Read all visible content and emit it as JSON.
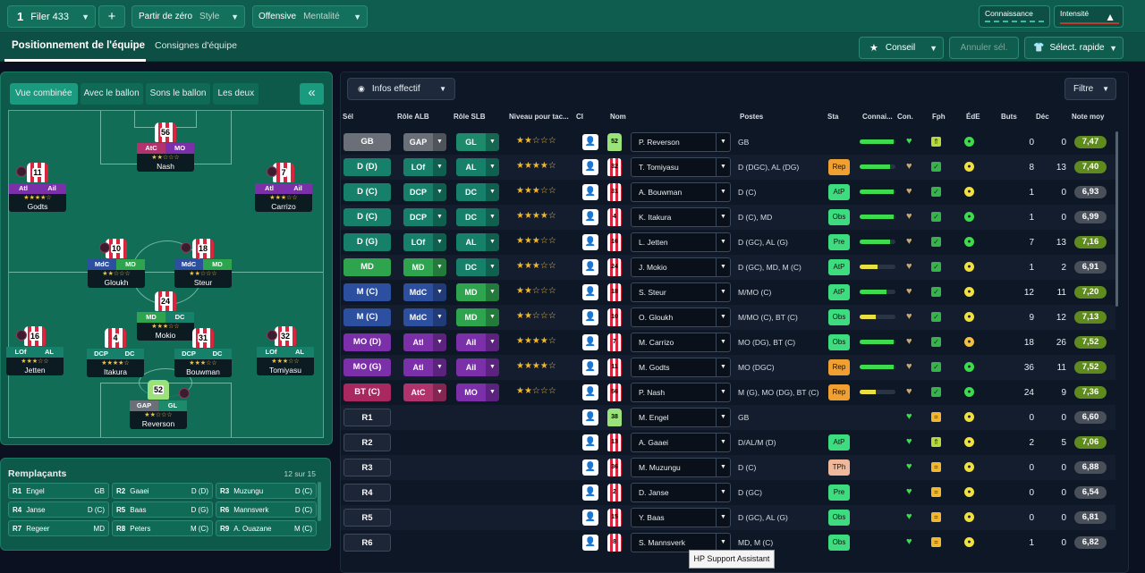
{
  "topbar": {
    "formation_number": "1",
    "formation_label": "Filer 433",
    "add_label": "+",
    "style_label": "Partir de zéro",
    "style_value": "Style",
    "mentality_label": "Offensive",
    "mentality_value": "Mentalité",
    "knowledge_label": "Connaissance",
    "intensity_label": "Intensité"
  },
  "tabs": {
    "positioning": "Positionnement de l'équipe",
    "instructions": "Consignes d'équipe"
  },
  "actions": {
    "advice": "Conseil",
    "cancel": "Annuler sél.",
    "quick_select": "Sélect. rapide"
  },
  "view_toggle": {
    "combined": "Vue combinée",
    "with_ball": "Avec le ballon",
    "without_ball": "Sons le ballon",
    "both": "Les deux",
    "collapse": "«"
  },
  "pitch_players": [
    {
      "num": "56",
      "r1": "AtC",
      "r2": "MO",
      "stars": "★★☆☆☆",
      "name": "Nash"
    },
    {
      "num": "11",
      "r1": "Atl",
      "r2": "Ail",
      "stars": "★★★★☆",
      "name": "Godts"
    },
    {
      "num": "7",
      "r1": "Atl",
      "r2": "Ail",
      "stars": "★★★☆☆",
      "name": "Carrizo"
    },
    {
      "num": "10",
      "r1": "MdC",
      "r2": "MD",
      "stars": "★★☆☆☆",
      "name": "Gloukh"
    },
    {
      "num": "18",
      "r1": "MdC",
      "r2": "MD",
      "stars": "★★☆☆☆",
      "name": "Steur"
    },
    {
      "num": "24",
      "r1": "MD",
      "r2": "DC",
      "stars": "★★★☆☆",
      "name": "Mokio"
    },
    {
      "num": "16",
      "r1": "LOf",
      "r2": "AL",
      "stars": "★★★☆☆",
      "name": "Jetten"
    },
    {
      "num": "4",
      "r1": "DCP",
      "r2": "DC",
      "stars": "★★★★☆",
      "name": "Itakura"
    },
    {
      "num": "31",
      "r1": "DCP",
      "r2": "DC",
      "stars": "★★★☆☆",
      "name": "Bouwman"
    },
    {
      "num": "32",
      "r1": "LOf",
      "r2": "AL",
      "stars": "★★★☆☆",
      "name": "Tomiyasu"
    },
    {
      "num": "52",
      "r1": "GAP",
      "r2": "GL",
      "stars": "★★☆☆☆",
      "name": "Reverson"
    }
  ],
  "subs": {
    "title": "Remplaçants",
    "count": "12 sur 15",
    "items": [
      {
        "slot": "R1",
        "name": "Engel",
        "pos": "GB"
      },
      {
        "slot": "R2",
        "name": "Gaaei",
        "pos": "D (D)"
      },
      {
        "slot": "R3",
        "name": "Muzungu",
        "pos": "D (C)"
      },
      {
        "slot": "R4",
        "name": "Janse",
        "pos": "D (C)"
      },
      {
        "slot": "R5",
        "name": "Baas",
        "pos": "D (G)"
      },
      {
        "slot": "R6",
        "name": "Mannsverk",
        "pos": "D (C)"
      },
      {
        "slot": "R7",
        "name": "Regeer",
        "pos": "MD"
      },
      {
        "slot": "R8",
        "name": "Peters",
        "pos": "M (C)"
      },
      {
        "slot": "R9",
        "name": "A. Ouazane",
        "pos": "M (C)"
      }
    ]
  },
  "main": {
    "info_button": "Infos effectif",
    "filter_button": "Filtre"
  },
  "columns": [
    "Sél",
    "Rôle ALB",
    "Rôle SLB",
    "Niveau pour tac...",
    "CI",
    "Nom",
    "Postes",
    "Sta",
    "Connai...",
    "Con.",
    "Fph",
    "ÉdE",
    "Buts",
    "Déc",
    "Note moy"
  ],
  "rows": [
    {
      "sel": "GB",
      "alb": "GAP",
      "slb": "GL",
      "stars": "★★☆☆☆",
      "num": "52",
      "name": "P. Reverson",
      "pos": "GB",
      "sta": "",
      "know": 0.95,
      "goals": "0",
      "dec": "0",
      "note": "7,47"
    },
    {
      "sel": "D (D)",
      "alb": "LOf",
      "slb": "AL",
      "stars": "★★★★☆",
      "num": "32",
      "name": "T. Tomiyasu",
      "pos": "D (DGC), AL (DG)",
      "sta": "Rep",
      "know": 0.85,
      "goals": "8",
      "dec": "13",
      "note": "7,40"
    },
    {
      "sel": "D (C)",
      "alb": "DCP",
      "slb": "DC",
      "stars": "★★★☆☆",
      "num": "31",
      "name": "A. Bouwman",
      "pos": "D (C)",
      "sta": "AtP",
      "know": 0.95,
      "goals": "1",
      "dec": "0",
      "note": "6,93"
    },
    {
      "sel": "D (C)",
      "alb": "DCP",
      "slb": "DC",
      "stars": "★★★★☆",
      "num": "4",
      "name": "K. Itakura",
      "pos": "D (C), MD",
      "sta": "Obs",
      "know": 0.95,
      "goals": "1",
      "dec": "0",
      "note": "6,99"
    },
    {
      "sel": "D (G)",
      "alb": "LOf",
      "slb": "AL",
      "stars": "★★★☆☆",
      "num": "16",
      "name": "L. Jetten",
      "pos": "D (GC), AL (G)",
      "sta": "Pre",
      "know": 0.85,
      "goals": "7",
      "dec": "13",
      "note": "7,16"
    },
    {
      "sel": "MD",
      "alb": "MD",
      "slb": "DC",
      "stars": "★★★☆☆",
      "num": "24",
      "name": "J. Mokio",
      "pos": "D (GC), MD, M (C)",
      "sta": "AtP",
      "know": 0.5,
      "goals": "1",
      "dec": "2",
      "note": "6,91"
    },
    {
      "sel": "M (C)",
      "alb": "MdC",
      "slb": "MD",
      "stars": "★★☆☆☆",
      "num": "18",
      "name": "S. Steur",
      "pos": "M/MO (C)",
      "sta": "AtP",
      "know": 0.75,
      "goals": "12",
      "dec": "11",
      "note": "7,20"
    },
    {
      "sel": "M (C)",
      "alb": "MdC",
      "slb": "MD",
      "stars": "★★☆☆☆",
      "num": "10",
      "name": "O. Gloukh",
      "pos": "M/MO (C), BT (C)",
      "sta": "Obs",
      "know": 0.45,
      "goals": "9",
      "dec": "12",
      "note": "7,13"
    },
    {
      "sel": "MO (D)",
      "alb": "Atl",
      "slb": "Ail",
      "stars": "★★★★☆",
      "num": "7",
      "name": "M. Carrizo",
      "pos": "MO (DG), BT (C)",
      "sta": "Obs",
      "know": 0.95,
      "goals": "18",
      "dec": "26",
      "note": "7,52"
    },
    {
      "sel": "MO (G)",
      "alb": "Atl",
      "slb": "Ail",
      "stars": "★★★★☆",
      "num": "11",
      "name": "M. Godts",
      "pos": "MO (DGC)",
      "sta": "Rep",
      "know": 0.95,
      "goals": "36",
      "dec": "11",
      "note": "7,52"
    },
    {
      "sel": "BT (C)",
      "alb": "AtC",
      "slb": "MO",
      "stars": "★★☆☆☆",
      "num": "56",
      "name": "P. Nash",
      "pos": "M (G), MO (DG), BT (C)",
      "sta": "Rep",
      "know": 0.45,
      "goals": "24",
      "dec": "9",
      "note": "7,36"
    },
    {
      "sel": "R1",
      "alb": "",
      "slb": "",
      "stars": "",
      "num": "38",
      "name": "M. Engel",
      "pos": "GB",
      "sta": "",
      "know": 0,
      "goals": "0",
      "dec": "0",
      "note": "6,60"
    },
    {
      "sel": "R2",
      "alb": "",
      "slb": "",
      "stars": "",
      "num": "13",
      "name": "A. Gaaei",
      "pos": "D/AL/M (D)",
      "sta": "AtP",
      "know": 0,
      "goals": "2",
      "dec": "5",
      "note": "7,06"
    },
    {
      "sel": "R3",
      "alb": "",
      "slb": "",
      "stars": "",
      "num": "36",
      "name": "M. Muzungu",
      "pos": "D (C)",
      "sta": "TPh",
      "know": 0,
      "goals": "0",
      "dec": "0",
      "note": "6,88"
    },
    {
      "sel": "R4",
      "alb": "",
      "slb": "",
      "stars": "",
      "num": "2",
      "name": "D. Janse",
      "pos": "D (GC)",
      "sta": "Pre",
      "know": 0,
      "goals": "0",
      "dec": "0",
      "note": "6,54"
    },
    {
      "sel": "R5",
      "alb": "",
      "slb": "",
      "stars": "",
      "num": "15",
      "name": "Y. Baas",
      "pos": "D (GC), AL (G)",
      "sta": "Obs",
      "know": 0,
      "goals": "0",
      "dec": "0",
      "note": "6,81"
    },
    {
      "sel": "R6",
      "alb": "",
      "slb": "",
      "stars": "",
      "num": "8",
      "name": "S. Mannsverk",
      "pos": "MD, M (C)",
      "sta": "Obs",
      "know": 0,
      "goals": "1",
      "dec": "0",
      "note": "6,82"
    }
  ],
  "tooltip": "HP Support Assistant",
  "colors": {
    "accent": "#13705d",
    "gk": "#6a6f78",
    "def": "#16806b",
    "mid": "#2ea44f",
    "cm": "#2c4fa0",
    "am": "#7b2fa8",
    "st": "#a8285f"
  }
}
